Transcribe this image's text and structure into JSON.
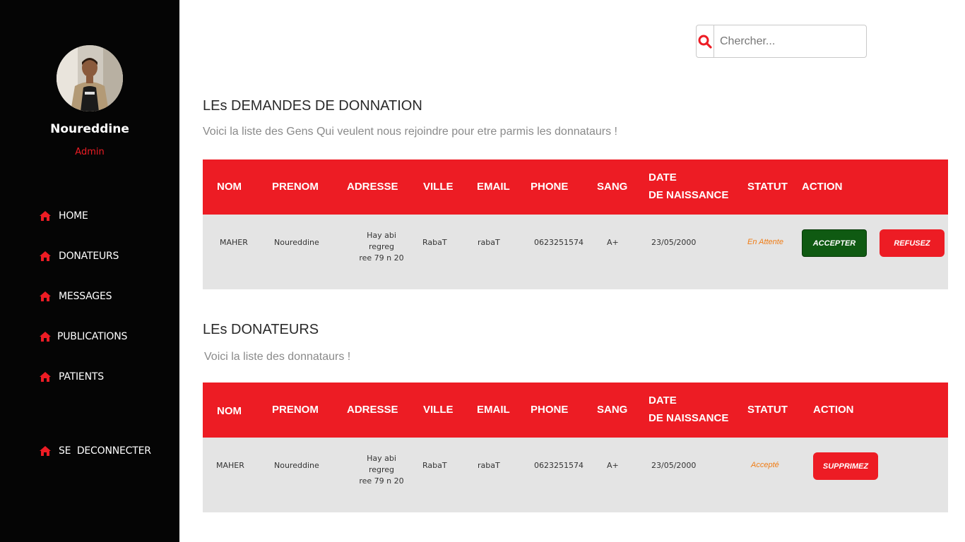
{
  "profile": {
    "name": "Noureddine",
    "role": "Admin"
  },
  "nav": [
    {
      "label": "HOME",
      "icon": "home-icon"
    },
    {
      "label": "DONATEURS",
      "icon": "home-icon"
    },
    {
      "label": "MESSAGES",
      "icon": "home-icon"
    },
    {
      "label": "PUBLICATIONS",
      "icon": "home-icon"
    },
    {
      "label": "PATIENTS",
      "icon": "home-icon"
    },
    {
      "label": "SE  DECONNECTER",
      "icon": "home-icon"
    }
  ],
  "search": {
    "placeholder": "Chercher...",
    "icon": "search-icon"
  },
  "demandes": {
    "title": "LEs DEMANDES DE DONNATION",
    "subtitle": "Voici la liste des Gens Qui veulent nous rejoindre pour etre parmis les donnataurs !",
    "headers": [
      "NOM",
      "PRENOM",
      "ADRESSE",
      "VILLE",
      "EMAIL",
      "PHONE",
      "SANG",
      "DATE",
      "DE NAISSANCE",
      "STATUT",
      "ACTION"
    ],
    "row": {
      "nom": "MAHER",
      "prenom": "Noureddine",
      "adresse_1": "Hay abi regreg",
      "adresse_2": "ree 79 n 20",
      "ville": "RabaT",
      "email": "rabaT",
      "phone": "0623251574",
      "sang": "A+",
      "date": "23/05/2000",
      "statut": "En Attente",
      "accept_label": "ACCEPTER",
      "refuse_label": "REFUSEZ"
    }
  },
  "donateurs": {
    "title": "LEs DONATEURS",
    "subtitle": "Voici la liste des donnataurs !",
    "headers": [
      "NOM",
      "PRENOM",
      "ADRESSE",
      "VILLE",
      "EMAIL",
      "PHONE",
      "SANG",
      "DATE",
      "DE NAISSANCE",
      "STATUT",
      "ACTION"
    ],
    "row": {
      "nom": "MAHER",
      "prenom": "Noureddine",
      "adresse_1": "Hay abi regreg",
      "adresse_2": "ree 79 n 20",
      "ville": "RabaT",
      "email": "rabaT",
      "phone": "0623251574",
      "sang": "A+",
      "date": "23/05/2000",
      "statut": "Accepté",
      "delete_label": "SUPPRIMEZ"
    }
  },
  "colors": {
    "accent": "#ed1c24",
    "sidebar": "#050505",
    "accept": "#0f5a12",
    "status": "#f07c14",
    "row_bg": "#e4e4e4"
  }
}
